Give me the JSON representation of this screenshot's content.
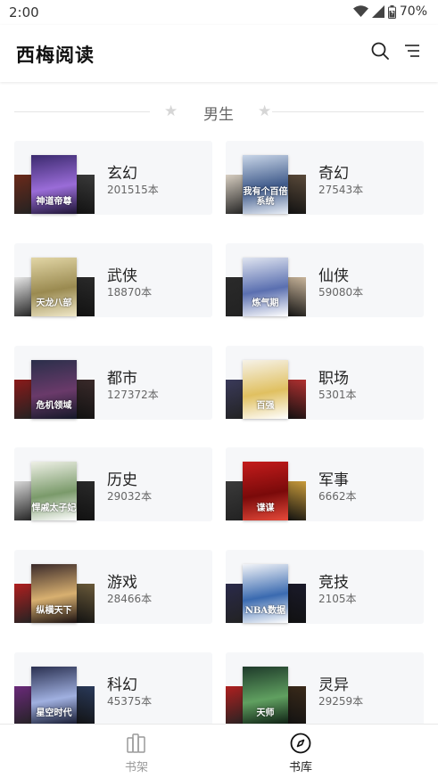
{
  "status_bar": {
    "time": "2:00",
    "battery": "70%"
  },
  "header": {
    "title": "西梅阅读",
    "search_icon": "search-icon",
    "menu_icon": "list-menu-icon"
  },
  "section": {
    "title": "男生"
  },
  "categories": [
    {
      "name": "玄幻",
      "count": "201515本",
      "main_cover_text": "神道帝尊",
      "colors": [
        "#3b2a6e",
        "#9a6cd8",
        "#1e1535"
      ],
      "side_colors": [
        "#6b2a1a",
        "#3a3a3a"
      ]
    },
    {
      "name": "奇幻",
      "count": "27543本",
      "main_cover_text": "我有个百倍系统",
      "colors": [
        "#c9d6e8",
        "#3f5a8a",
        "#e8eef7"
      ],
      "side_colors": [
        "#d8cfc2",
        "#5a4a3a"
      ]
    },
    {
      "name": "武侠",
      "count": "18870本",
      "main_cover_text": "天龙八部",
      "colors": [
        "#e2d6a6",
        "#9a8a50",
        "#f0e8c8"
      ],
      "side_colors": [
        "#e8e8e8",
        "#2a2a2a"
      ]
    },
    {
      "name": "仙侠",
      "count": "59080本",
      "main_cover_text": "炼气期",
      "colors": [
        "#dfe4f0",
        "#5a6fb0",
        "#ffffff"
      ],
      "side_colors": [
        "#2a2a2a",
        "#c8b49a"
      ]
    },
    {
      "name": "都市",
      "count": "127372本",
      "main_cover_text": "危机领域",
      "colors": [
        "#2a2f4a",
        "#6a3a6a",
        "#141828"
      ],
      "side_colors": [
        "#8a1a1a",
        "#3a2a2a"
      ]
    },
    {
      "name": "职场",
      "count": "5301本",
      "main_cover_text": "百强",
      "colors": [
        "#f6f2e8",
        "#e0c060",
        "#ffffff"
      ],
      "side_colors": [
        "#3a3a5a",
        "#b03030"
      ]
    },
    {
      "name": "历史",
      "count": "29032本",
      "main_cover_text": "悍戚太子妃",
      "colors": [
        "#eef0e6",
        "#7a9a6a",
        "#ffffff"
      ],
      "side_colors": [
        "#d8d8d8",
        "#2a2a2a"
      ]
    },
    {
      "name": "军事",
      "count": "6662本",
      "main_cover_text": "谍谋",
      "colors": [
        "#c41c1c",
        "#7a0a0a",
        "#e64a3a"
      ],
      "side_colors": [
        "#3a3a3a",
        "#c89a3a"
      ]
    },
    {
      "name": "游戏",
      "count": "28466本",
      "main_cover_text": "纵横天下",
      "colors": [
        "#3a2a2a",
        "#d8b070",
        "#1a1010"
      ],
      "side_colors": [
        "#b02020",
        "#6a5a3a"
      ]
    },
    {
      "name": "竞技",
      "count": "2105本",
      "main_cover_text": "NBA数据",
      "colors": [
        "#f2f4f8",
        "#3a6ab0",
        "#ffffff"
      ],
      "side_colors": [
        "#2a2a4a",
        "#1a1a2a"
      ]
    },
    {
      "name": "科幻",
      "count": "45375本",
      "main_cover_text": "星空时代",
      "colors": [
        "#2a3050",
        "#a0b0e0",
        "#10142a"
      ],
      "side_colors": [
        "#6a2a7a",
        "#2a3a5a"
      ]
    },
    {
      "name": "灵异",
      "count": "29259本",
      "main_cover_text": "天师",
      "colors": [
        "#1e3a2a",
        "#60a060",
        "#0a1a10"
      ],
      "side_colors": [
        "#b02020",
        "#3a2a1a"
      ]
    }
  ],
  "bottom_nav": [
    {
      "label": "书架",
      "icon": "bookshelf-icon",
      "active": false
    },
    {
      "label": "书库",
      "icon": "compass-icon",
      "active": true
    }
  ]
}
